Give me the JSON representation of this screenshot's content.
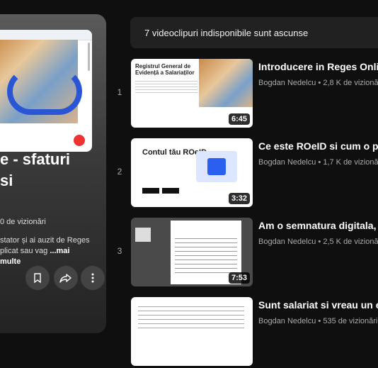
{
  "playlist": {
    "title": "e - sfaturi si",
    "views": "0 de vizionări",
    "description": "stator și ai auzit de Reges plicat sau vag",
    "more_label": "...mai multe"
  },
  "hidden_notice": "7 videoclipuri indisponibile sunt ascunse",
  "videos": [
    {
      "index": "1",
      "title": "Introducere in Reges Online",
      "channel": "Bogdan Nedelcu",
      "views": "2,8 K de vizionări",
      "duration": "6:45",
      "thumb_heading": "Registrul General de Evidență a Salariaților"
    },
    {
      "index": "2",
      "title": "Ce este ROeID si cum o pot",
      "channel": "Bogdan Nedelcu",
      "views": "1,7 K de vizionări",
      "duration": "3:32",
      "thumb_heading": "Contul tău ROeID"
    },
    {
      "index": "3",
      "title": "Am o semnatura digitala, cu",
      "channel": "Bogdan Nedelcu",
      "views": "2,5 K de vizionări",
      "duration": "7:53"
    },
    {
      "index": "",
      "title": "Sunt salariat si vreau un ext",
      "channel": "Bogdan Nedelcu",
      "views": "535 de vizionări",
      "duration": ""
    }
  ],
  "separator": "•",
  "icons": {
    "save": "bookmark-icon",
    "share": "share-icon",
    "more": "more-vert-icon"
  }
}
